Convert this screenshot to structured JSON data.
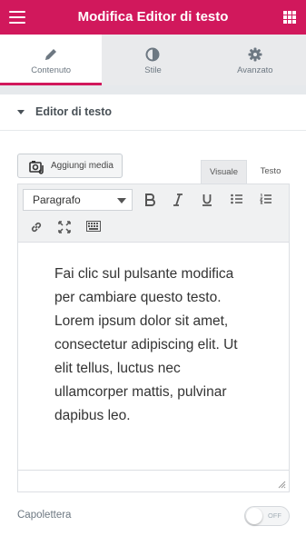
{
  "header": {
    "title": "Modifica Editor di testo",
    "icons": {
      "menu": "hamburger-icon",
      "apps": "grid-icon"
    },
    "color": "#d1185c"
  },
  "tabs": [
    {
      "label": "Contenuto",
      "icon": "pencil-icon",
      "active": true
    },
    {
      "label": "Stile",
      "icon": "contrast-icon",
      "active": false
    },
    {
      "label": "Avanzato",
      "icon": "gear-icon",
      "active": false
    }
  ],
  "section": {
    "title": "Editor di testo",
    "expanded": true
  },
  "editor": {
    "add_media_label": "Aggiungi media",
    "mode_tabs": [
      {
        "label": "Visuale",
        "active": true
      },
      {
        "label": "Testo",
        "active": false
      }
    ],
    "format_value": "Paragrafo",
    "toolbar_icons": [
      "bold-icon",
      "italic-icon",
      "underline-icon",
      "bullet-list-icon",
      "numbered-list-icon",
      "link-icon",
      "fullscreen-icon",
      "keyboard-icon"
    ],
    "content": "Fai clic sul pulsante modifica per cambiare questo testo. Lorem ipsum dolor sit amet, consectetur adipiscing elit. Ut elit tellus, luctus nec ullamcorper mattis, pulvinar dapibus leo."
  },
  "drop_cap": {
    "label": "Capolettera",
    "toggle_state": "OFF"
  }
}
